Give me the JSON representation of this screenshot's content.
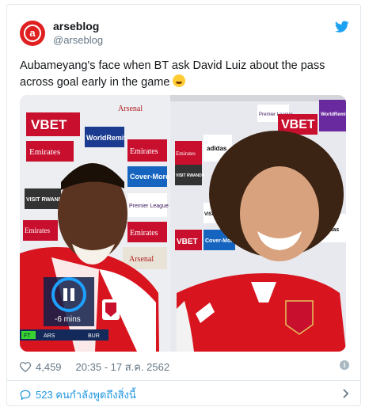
{
  "author": {
    "name": "arseblog",
    "handle": "@arseblog"
  },
  "tweet": {
    "text": "Aubameyang's face when BT ask David Luiz about the pass across goal early in the game"
  },
  "media": {
    "board_words": [
      "VBET",
      "Emirates",
      "WorldRemit",
      "Cover-More",
      "VISIT RWANDA",
      "adidas",
      "Arsenal",
      "Premier League"
    ],
    "overlay": {
      "countdown": "-6 mins",
      "score_label": "FT",
      "team_a": "ARS",
      "team_b": "BUR"
    }
  },
  "stats": {
    "likes": "4,459",
    "timestamp": "20:35 - 17 ส.ค. 2562"
  },
  "footer": {
    "replies": "523 คนกำลังพูดถึงสิ่งนี้"
  },
  "colors": {
    "twitter_blue": "#1da1f2",
    "arsenal_red": "#db0007",
    "link_blue": "#1b95e0"
  }
}
